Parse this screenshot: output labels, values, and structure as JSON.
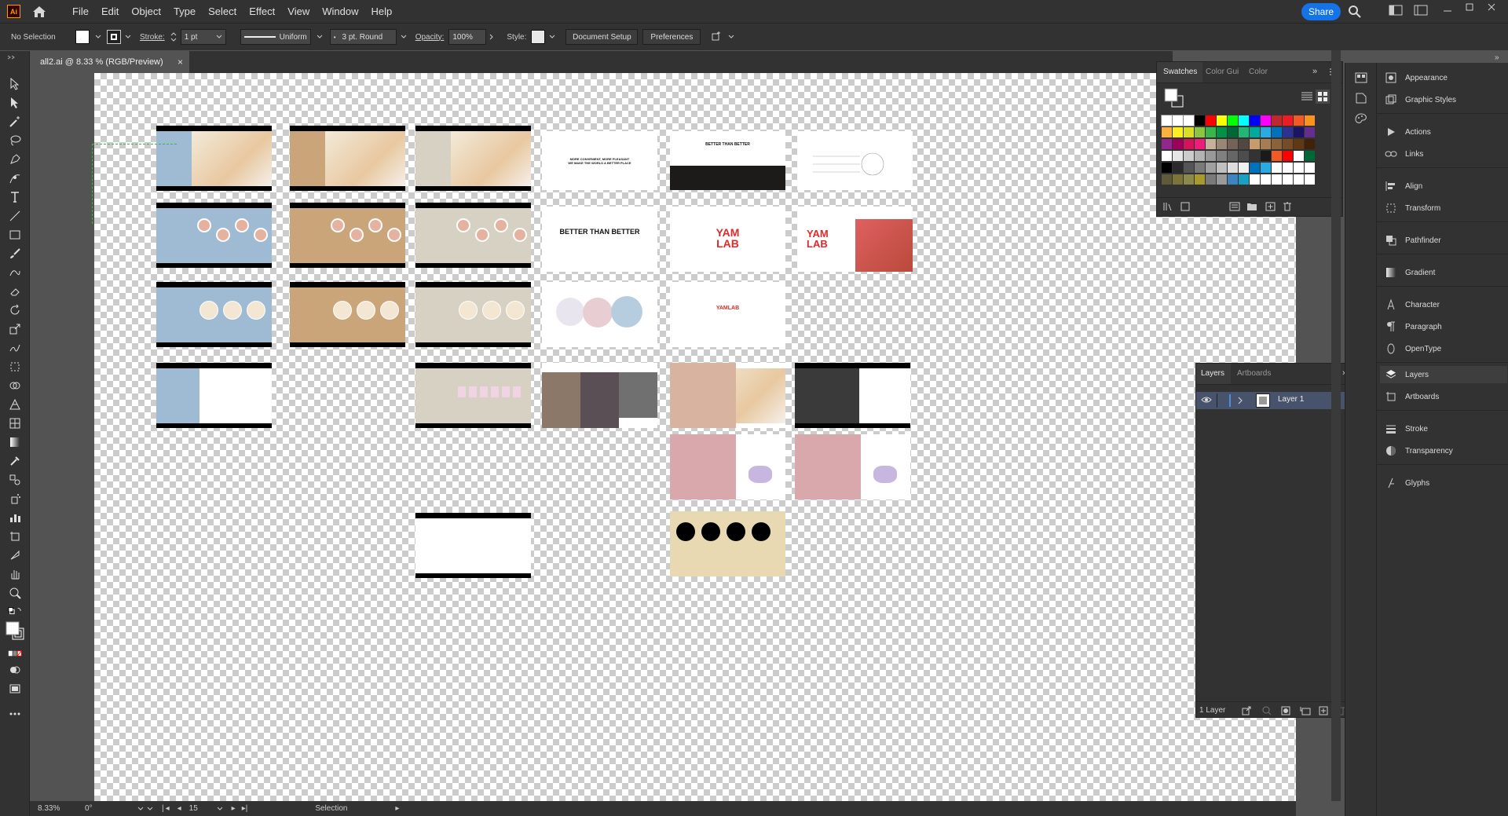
{
  "app": {
    "logo": "Ai",
    "home_icon": "home-icon"
  },
  "menu": [
    "File",
    "Edit",
    "Object",
    "Type",
    "Select",
    "Effect",
    "View",
    "Window",
    "Help"
  ],
  "topbar": {
    "share": "Share"
  },
  "control": {
    "selection": "No Selection",
    "stroke_label": "Stroke:",
    "stroke_value": "1 pt",
    "profile": "Uniform",
    "brush": "3 pt. Round",
    "opacity_label": "Opacity:",
    "opacity_value": "100%",
    "style_label": "Style:",
    "doc_setup": "Document Setup",
    "preferences": "Preferences"
  },
  "document": {
    "tab_title": "all2.ai @ 8.33 % (RGB/Preview)"
  },
  "status": {
    "zoom": "8.33%",
    "rotation": "0°",
    "artboard": "15",
    "tool": "Selection"
  },
  "swatches_panel": {
    "tabs": [
      "Swatches",
      "Color Gui",
      "Color"
    ]
  },
  "layers_panel": {
    "tabs": [
      "Layers",
      "Artboards"
    ],
    "layer_name": "Layer 1",
    "footer": "1 Layer"
  },
  "dock": [
    "Appearance",
    "Graphic Styles",
    "Actions",
    "Links",
    "Align",
    "Transform",
    "Pathfinder",
    "Gradient",
    "Character",
    "Paragraph",
    "OpenType",
    "Layers",
    "Artboards",
    "Stroke",
    "Transparency",
    "Glyphs"
  ],
  "artboard_text": {
    "t1": "MORE CONVENIENT, MORE PLEASANT",
    "t2": "WE MAKE THE WORLD A BETTER PLACE",
    "btb": "BETTER THAN BETTER",
    "yamlab": "YAMLAB",
    "yam": "YAM",
    "lab": "LAB"
  },
  "colors": {
    "accent": "#1473e6",
    "layer_color": "#4f8bd6",
    "canvas": "#535353",
    "panel": "#323232"
  },
  "swatch_rows": [
    [
      "#ffffff",
      "#ffffff",
      "#ffffff",
      "#000000",
      "#ff0000",
      "#ffff00",
      "#00ff00",
      "#00ffff",
      "#0000ff",
      "#ff00ff",
      "#c1272d",
      "#ed1c24",
      "#f15a24",
      "#f7931e"
    ],
    [
      "#fbb03b",
      "#fcee21",
      "#d9e021",
      "#8cc63f",
      "#39b54a",
      "#009245",
      "#006837",
      "#22b573",
      "#00a99d",
      "#29abe2",
      "#0071bc",
      "#2e3192",
      "#1b1464",
      "#662d91"
    ],
    [
      "#93278f",
      "#9e005d",
      "#d4145a",
      "#ed1e79",
      "#c7b299",
      "#998675",
      "#736357",
      "#534741",
      "#c69c6d",
      "#a67c52",
      "#8c6239",
      "#754c24",
      "#603813",
      "#42210b"
    ],
    [
      "#ffffff",
      "#e6e6e6",
      "#cccccc",
      "#b3b3b3",
      "#999999",
      "#808080",
      "#666666",
      "#4d4d4d",
      "#333333",
      "#1a1a1a",
      "#f15a24",
      "#ff0000",
      "#ffffff",
      "#006837"
    ],
    [
      "#000000",
      "#2a2a2a",
      "#555555",
      "#7a7a7a",
      "#a0a0a0",
      "#c0c0c0",
      "#dddddd",
      "#f0f0f0",
      "#0071bc",
      "#29abe2",
      "#ffffff",
      "#ffffff",
      "#ffffff",
      "#ffffff"
    ],
    [
      "#5f5a3a",
      "#7c7438",
      "#8a8a4c",
      "#a89a2c",
      "#7a7a7a",
      "#9a9a9a",
      "#3e84c0",
      "#1aa0c0",
      "#ffffff",
      "#ffffff",
      "#ffffff",
      "#ffffff",
      "#ffffff",
      "#ffffff"
    ]
  ]
}
